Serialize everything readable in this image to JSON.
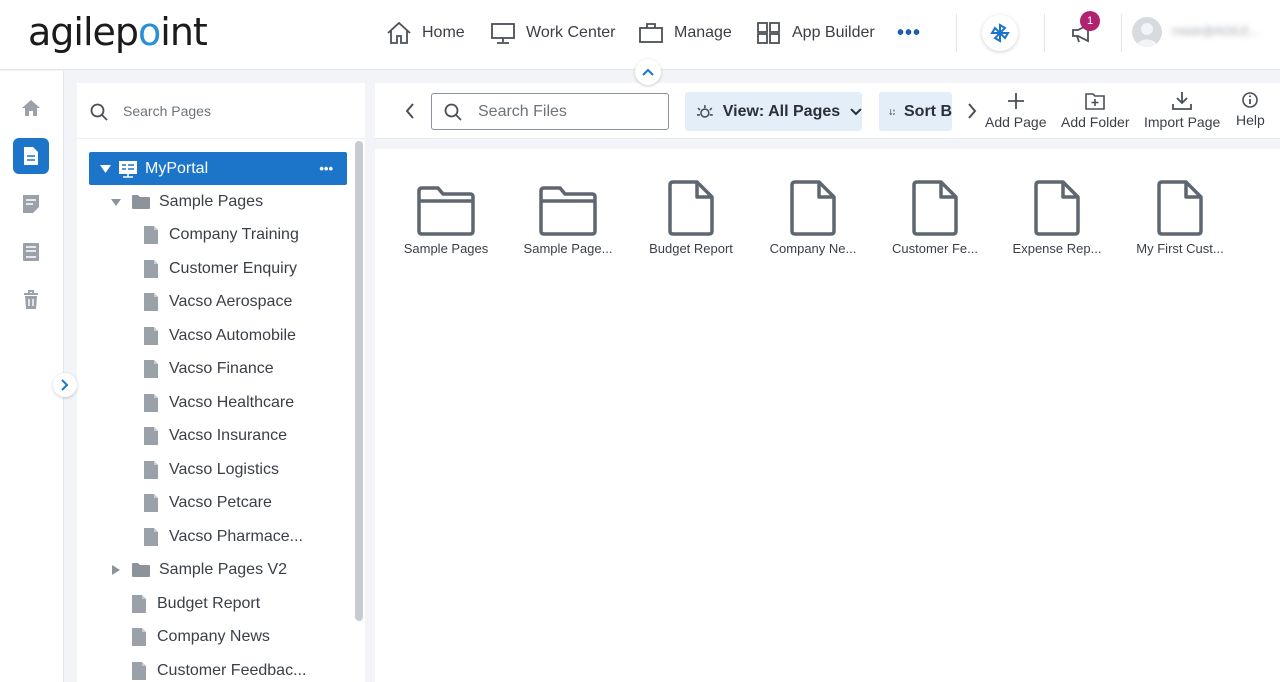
{
  "header": {
    "logo_text_a": "agilep",
    "logo_text_b": "int",
    "nav": [
      {
        "label": "Home"
      },
      {
        "label": "Work Center"
      },
      {
        "label": "Manage"
      },
      {
        "label": "App Builder"
      }
    ],
    "more_label": "•••",
    "notification_count": "1",
    "username": "rnasir@AGILE..."
  },
  "tree": {
    "search_placeholder": "Search Pages",
    "root": {
      "label": "MyPortal",
      "more": "•••"
    },
    "items": [
      {
        "label": "Sample Pages",
        "type": "folder",
        "expanded": true
      },
      {
        "label": "Company Training",
        "type": "page"
      },
      {
        "label": "Customer Enquiry",
        "type": "page"
      },
      {
        "label": "Vacso Aerospace",
        "type": "page"
      },
      {
        "label": "Vacso Automobile",
        "type": "page"
      },
      {
        "label": "Vacso Finance",
        "type": "page"
      },
      {
        "label": "Vacso Healthcare",
        "type": "page"
      },
      {
        "label": "Vacso Insurance",
        "type": "page"
      },
      {
        "label": "Vacso Logistics",
        "type": "page"
      },
      {
        "label": "Vacso Petcare",
        "type": "page"
      },
      {
        "label": "Vacso Pharmace...",
        "type": "page"
      },
      {
        "label": "Sample Pages V2",
        "type": "folder",
        "expanded": false
      },
      {
        "label": "Budget Report",
        "type": "page"
      },
      {
        "label": "Company News",
        "type": "page"
      },
      {
        "label": "Customer Feedbac...",
        "type": "page"
      }
    ]
  },
  "toolbar": {
    "search_placeholder": "Search Files",
    "view_label": "View: All Pages",
    "sort_label": "Sort B",
    "add_page": "Add Page",
    "add_folder": "Add Folder",
    "import_page": "Import Page",
    "help": "Help"
  },
  "files": [
    {
      "name": "Sample Pages",
      "type": "folder"
    },
    {
      "name": "Sample Page...",
      "type": "folder"
    },
    {
      "name": "Budget Report",
      "type": "page"
    },
    {
      "name": "Company Ne...",
      "type": "page"
    },
    {
      "name": "Customer Fe...",
      "type": "page"
    },
    {
      "name": "Expense Rep...",
      "type": "page"
    },
    {
      "name": "My First Cust...",
      "type": "page"
    }
  ],
  "colors": {
    "accent": "#1d75c9",
    "badge": "#b0216e",
    "icon": "#5f6670"
  }
}
